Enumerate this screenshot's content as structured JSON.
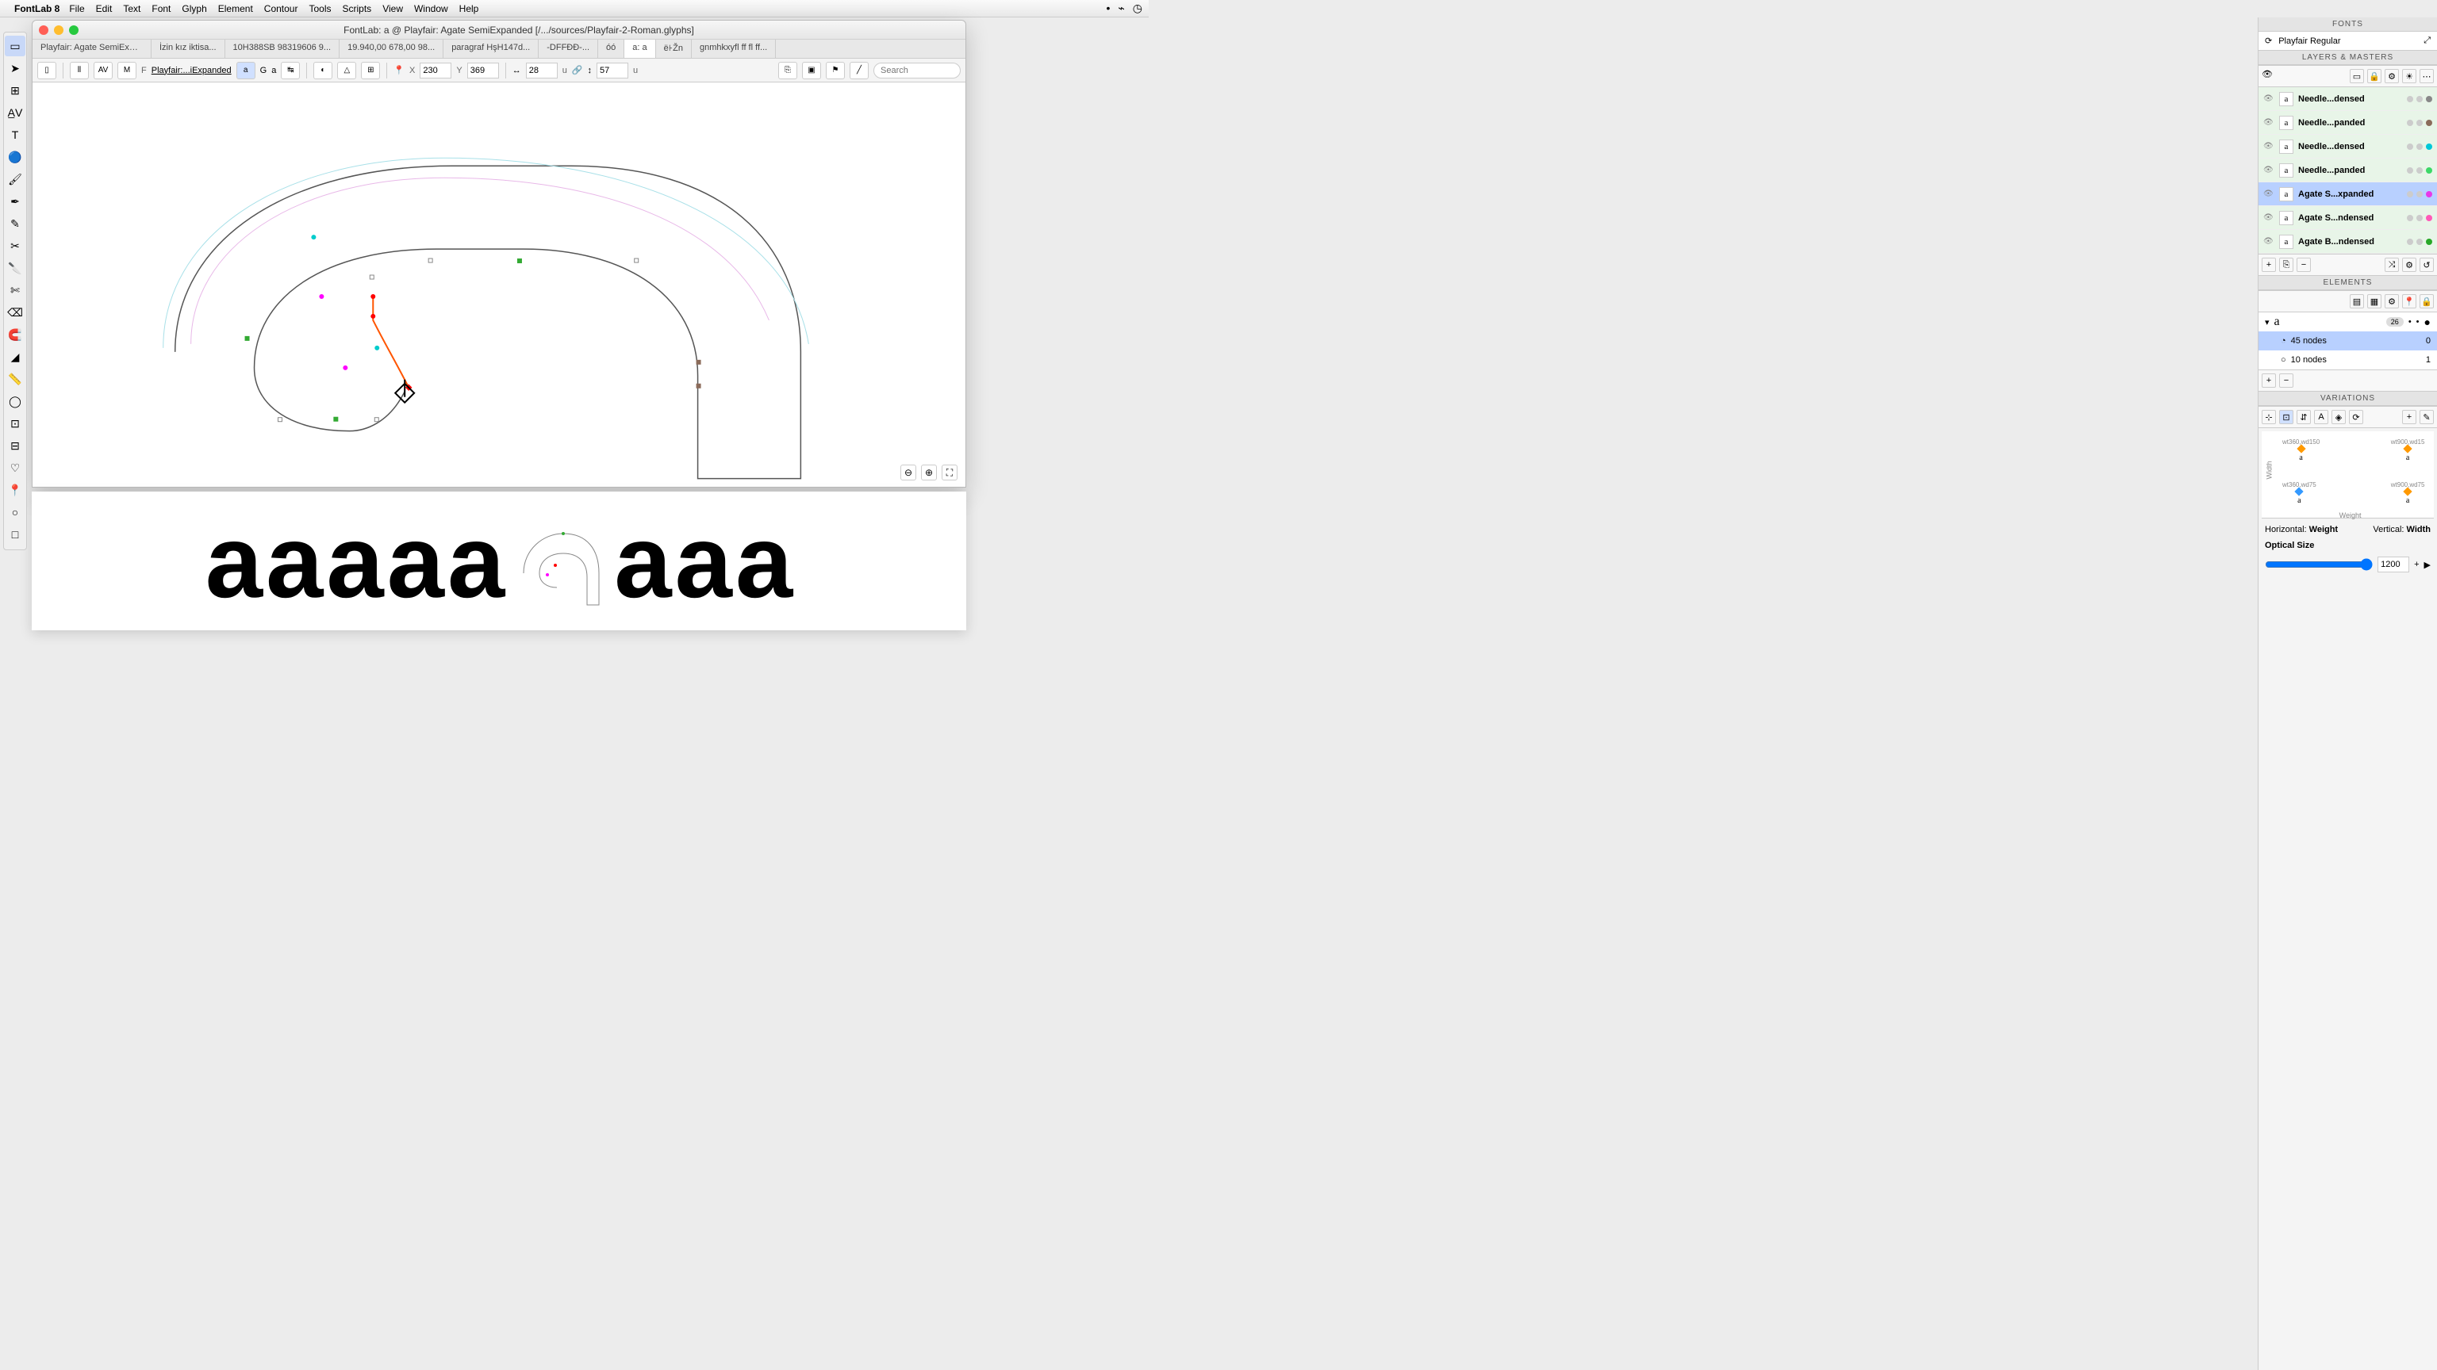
{
  "menubar": {
    "app": "FontLab 8",
    "items": [
      "File",
      "Edit",
      "Text",
      "Font",
      "Glyph",
      "Element",
      "Contour",
      "Tools",
      "Scripts",
      "View",
      "Window",
      "Help"
    ]
  },
  "window": {
    "title": "FontLab: a @ Playfair: Agate SemiExpanded [/.../sources/Playfair-2-Roman.glyphs]"
  },
  "tabs": [
    "Playfair: Agate SemiExpanded",
    "İzin kız iktisa...",
    "10H388SB 98319606 9...",
    "19.940,00 678,00 98...",
    "paragraf HşH147d...",
    "-DFFĐĐ-...",
    "óó",
    "a: a",
    "ё꜔Žn",
    "gnmhkxyfl ff fl ff..."
  ],
  "active_tab_index": 7,
  "toolbar": {
    "font_label": "F",
    "font_name": "Playfair:...iExpanded",
    "mode_a": "a",
    "mode_g": "G",
    "mode_a2": "a",
    "x_label": "X",
    "x_val": "230",
    "y_label": "Y",
    "y_val": "369",
    "w_val": "28",
    "w_unit": "u",
    "h_val": "57",
    "h_unit": "u"
  },
  "search_placeholder": "Search",
  "fonts_panel": {
    "title": "FONTS",
    "current": "Playfair Regular"
  },
  "layers_panel": {
    "title": "LAYERS & MASTERS",
    "rows": [
      {
        "name": "Needle...densed",
        "color": "#888888"
      },
      {
        "name": "Needle...panded",
        "color": "#8b6b5a"
      },
      {
        "name": "Needle...densed",
        "color": "#00c8d8"
      },
      {
        "name": "Needle...panded",
        "color": "#3dd868"
      },
      {
        "name": "Agate S...xpanded",
        "color": "#e838e8",
        "selected": true
      },
      {
        "name": "Agate S...ndensed",
        "color": "#ff5ab8"
      },
      {
        "name": "Agate B...ndensed",
        "color": "#28a828"
      }
    ]
  },
  "elements_panel": {
    "title": "ELEMENTS",
    "glyph": "a",
    "badge": "26",
    "rows": [
      {
        "label": "45 nodes",
        "val": "0",
        "selected": true
      },
      {
        "label": "10 nodes",
        "val": "1"
      }
    ]
  },
  "variations_panel": {
    "title": "VARIATIONS",
    "points": [
      {
        "label": "wt360,wd150",
        "x": 12,
        "y": 8,
        "color": "orange"
      },
      {
        "label": "wt900,wd15",
        "x": 75,
        "y": 8,
        "color": "orange"
      },
      {
        "label": "wt360,wd75",
        "x": 12,
        "y": 58,
        "color": "blue"
      },
      {
        "label": "wt900,wd75",
        "x": 75,
        "y": 58,
        "color": "orange"
      }
    ],
    "y_axis": "Width",
    "x_axis": "Weight",
    "horiz_label": "Horizontal:",
    "horiz_val": "Weight",
    "vert_label": "Vertical:",
    "vert_val": "Width",
    "optical_label": "Optical Size",
    "optical_val": "1200"
  },
  "preview_glyphs": [
    "a",
    "a",
    "a",
    "a",
    "a",
    "a",
    "a",
    "a"
  ]
}
